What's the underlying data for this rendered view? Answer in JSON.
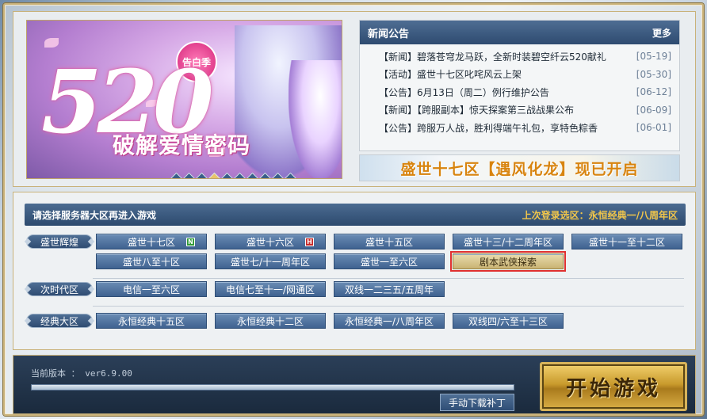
{
  "banner": {
    "badge": "告白季",
    "big_text": "520",
    "subtitle": "破解爱情密码",
    "dots_total": 10,
    "dots_active_index": 3
  },
  "news": {
    "title": "新闻公告",
    "more": "更多",
    "items": [
      {
        "text": "【新闻】碧落苍穹龙马跃，全新时装碧空纤云520献礼",
        "date": "[05-19]"
      },
      {
        "text": "【活动】盛世十七区叱咤风云上架",
        "date": "[05-30]"
      },
      {
        "text": "【公告】6月13日（周二）例行维护公告",
        "date": "[06-12]"
      },
      {
        "text": "【新闻】【跨服副本】惊天探案第三战战果公布",
        "date": "[06-09]"
      },
      {
        "text": "【公告】跨服万人战，胜利得端午礼包，享特色粽香",
        "date": "[06-01]"
      }
    ]
  },
  "open_banner": "盛世十七区【遇风化龙】现已开启",
  "servers": {
    "title": "请选择服务器大区再进入游戏",
    "last_login": "上次登录选区：永恒经典一/八周年区",
    "groups": [
      {
        "label": "盛世辉煌",
        "rows": [
          [
            {
              "name": "盛世十七区",
              "tag": "N"
            },
            {
              "name": "盛世十六区",
              "tag": "H"
            },
            {
              "name": "盛世十五区"
            },
            {
              "name": "盛世十三/十二周年区"
            },
            {
              "name": "盛世十一至十二区"
            }
          ],
          [
            {
              "name": "盛世八至十区"
            },
            {
              "name": "盛世七/十一周年区"
            },
            {
              "name": "盛世一至六区"
            },
            {
              "name": "剧本武侠探索",
              "special": true
            }
          ]
        ]
      },
      {
        "label": "次时代区",
        "rows": [
          [
            {
              "name": "电信一至六区"
            },
            {
              "name": "电信七至十一/网通区"
            },
            {
              "name": "双线一二三五/五周年"
            }
          ]
        ]
      },
      {
        "label": "经典大区",
        "rows": [
          [
            {
              "name": "永恒经典十五区"
            },
            {
              "name": "永恒经典十二区"
            },
            {
              "name": "永恒经典一/八周年区"
            },
            {
              "name": "双线四/六至十三区"
            }
          ]
        ]
      }
    ]
  },
  "footer": {
    "version": "当前版本 ： ver6.9.00",
    "progress": 1.0,
    "patch_button": "手动下载补丁",
    "start_button": "开始游戏"
  },
  "colors": {
    "accent_gold": "#c9b27a",
    "button_blue": "#3f6290",
    "news_header": "#2e4b70",
    "highlight_red": "#e0302f",
    "open_banner_orange": "#d8840f"
  }
}
